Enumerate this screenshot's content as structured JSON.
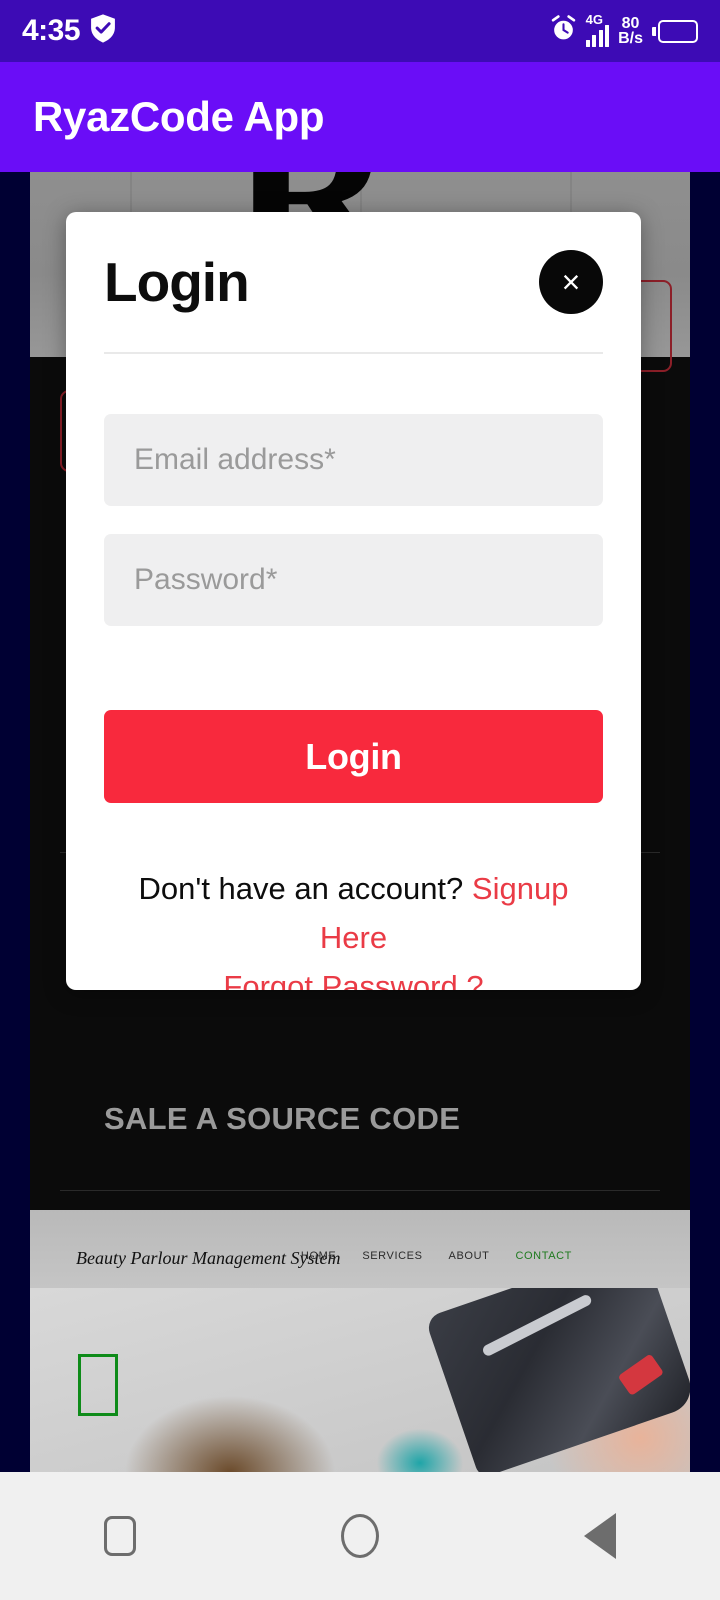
{
  "status_bar": {
    "time": "4:35",
    "shield_icon": "shield-check-icon",
    "alarm_icon": "alarm-clock-icon",
    "network_type": "4G",
    "network_speed_value": "80",
    "network_speed_unit": "B/s",
    "battery_icon": "battery-icon",
    "background_color": "#3d0bb5"
  },
  "app_bar": {
    "title": "RyazCode App",
    "background_color": "#6a0df7",
    "text_color": "#ffffff"
  },
  "modal": {
    "title": "Login",
    "close_label": "×",
    "close_icon": "close-x-icon",
    "email": {
      "placeholder": "Email address*",
      "value": ""
    },
    "password": {
      "placeholder": "Password*",
      "value": ""
    },
    "submit_label": "Login",
    "submit_color": "#f8293d",
    "footer": {
      "prompt": "Don't have an account?",
      "signup_link": "Signup Here",
      "forgot_link": "Forgot Password ?",
      "link_color": "#ea3b46"
    }
  },
  "page": {
    "hero_logo_letter": "R",
    "section_title": "SALE A SOURCE CODE",
    "section_title_color": "#9a9a9a",
    "background_color": "#0b0b0b",
    "edge_color": "#000033",
    "product_card": {
      "brand": "Beauty Parlour Management System",
      "nav": [
        {
          "label": "HOME",
          "active": false
        },
        {
          "label": "SERVICES",
          "active": false
        },
        {
          "label": "ABOUT",
          "active": false
        },
        {
          "label": "CONTACT",
          "active": true
        }
      ],
      "active_color": "#1f7a1f"
    }
  },
  "nav_bar": {
    "recents_icon": "square-recents-icon",
    "home_icon": "circle-home-icon",
    "back_icon": "triangle-back-icon",
    "background_color": "#f0f0f0"
  }
}
